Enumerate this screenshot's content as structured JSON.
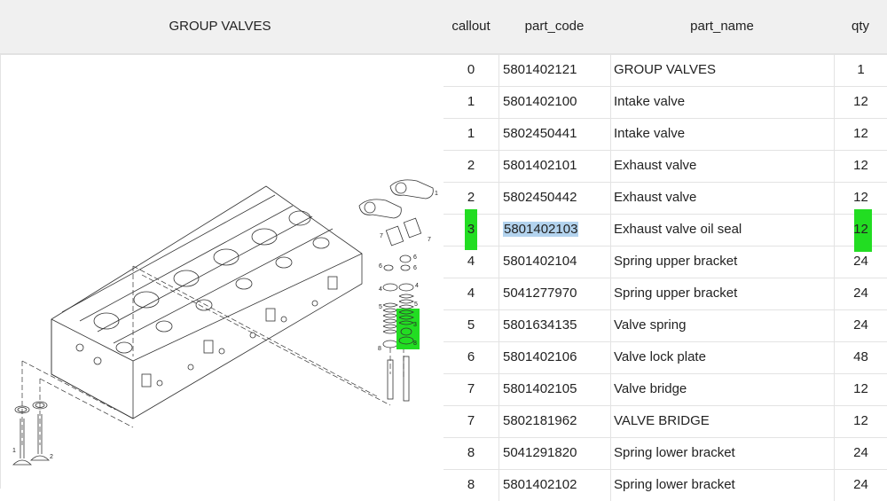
{
  "header": {
    "title": "GROUP VALVES",
    "columns": [
      "callout",
      "part_code",
      "part_name",
      "qty"
    ]
  },
  "diagram": {
    "callouts": [
      "1",
      "2",
      "3",
      "4",
      "5",
      "6",
      "7",
      "8"
    ],
    "highlight_color": "#22dd22"
  },
  "rows": [
    {
      "callout": "0",
      "part_code": "5801402121",
      "part_name": "GROUP VALVES",
      "qty": "1"
    },
    {
      "callout": "1",
      "part_code": "5801402100",
      "part_name": "Intake valve",
      "qty": "12"
    },
    {
      "callout": "1",
      "part_code": "5802450441",
      "part_name": "Intake valve",
      "qty": "12"
    },
    {
      "callout": "2",
      "part_code": "5801402101",
      "part_name": "Exhaust valve",
      "qty": "12"
    },
    {
      "callout": "2",
      "part_code": "5802450442",
      "part_name": "Exhaust valve",
      "qty": "12"
    },
    {
      "callout": "3",
      "part_code": "5801402103",
      "part_name": "Exhaust valve oil seal",
      "qty": "12",
      "highlighted": true
    },
    {
      "callout": "4",
      "part_code": "5801402104",
      "part_name": "Spring upper bracket",
      "qty": "24"
    },
    {
      "callout": "4",
      "part_code": "5041277970",
      "part_name": "Spring upper bracket",
      "qty": "24"
    },
    {
      "callout": "5",
      "part_code": "5801634135",
      "part_name": "Valve spring",
      "qty": "24"
    },
    {
      "callout": "6",
      "part_code": "5801402106",
      "part_name": "Valve lock plate",
      "qty": "48"
    },
    {
      "callout": "7",
      "part_code": "5801402105",
      "part_name": "Valve bridge",
      "qty": "12"
    },
    {
      "callout": "7",
      "part_code": "5802181962",
      "part_name": "VALVE BRIDGE",
      "qty": "12"
    },
    {
      "callout": "8",
      "part_code": "5041291820",
      "part_name": "Spring lower bracket",
      "qty": "24"
    },
    {
      "callout": "8",
      "part_code": "5801402102",
      "part_name": "Spring lower bracket",
      "qty": "24"
    }
  ]
}
